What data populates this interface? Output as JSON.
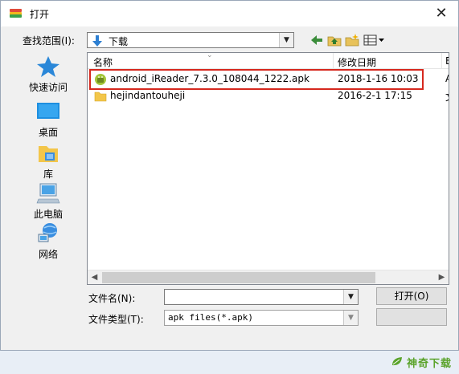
{
  "window": {
    "title": "打开",
    "close_glyph": "✕"
  },
  "toolbar": {
    "look_in_label": "查找范围(I):",
    "look_in_value": "下载",
    "look_in_icon": "download-arrow-icon",
    "buttons": [
      "back-icon",
      "up-folder-icon",
      "new-folder-icon",
      "view-menu-icon"
    ]
  },
  "places": [
    {
      "label": "快速访问",
      "icon": "star-icon"
    },
    {
      "label": "桌面",
      "icon": "desktop-icon"
    },
    {
      "label": "库",
      "icon": "library-icon"
    },
    {
      "label": "此电脑",
      "icon": "computer-icon"
    },
    {
      "label": "网络",
      "icon": "network-icon"
    }
  ],
  "columns": {
    "name": "名称",
    "modified": "修改日期",
    "truncated": "E"
  },
  "files": [
    {
      "name": "android_iReader_7.3.0_108044_1222.apk",
      "modified": "2018-1-16 10:03",
      "extra": "A",
      "icon": "apk-icon",
      "highlighted": true
    },
    {
      "name": "hejindantouheji",
      "modified": "2016-2-1 17:15",
      "extra": "文",
      "icon": "folder-icon",
      "highlighted": false
    }
  ],
  "footer": {
    "filename_label": "文件名(N):",
    "filename_value": "",
    "filetype_label": "文件类型(T):",
    "filetype_value": "apk files(*.apk)",
    "open_button": "打开(O)",
    "cancel_button": ""
  },
  "watermark": {
    "text": "神奇下载"
  },
  "colors": {
    "highlight_border": "#d6281e",
    "watermark_green": "#5aa32b"
  }
}
